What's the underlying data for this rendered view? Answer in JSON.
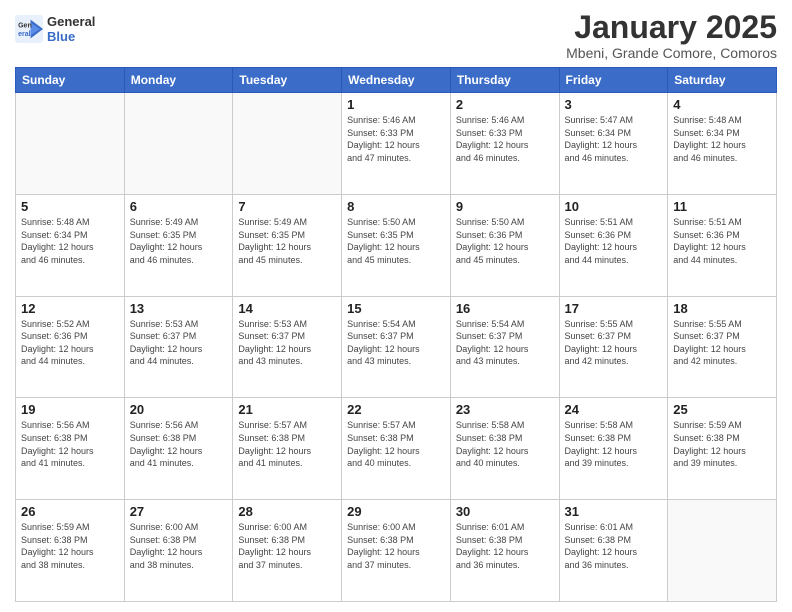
{
  "header": {
    "logo_line1": "General",
    "logo_line2": "Blue",
    "month": "January 2025",
    "location": "Mbeni, Grande Comore, Comoros"
  },
  "weekdays": [
    "Sunday",
    "Monday",
    "Tuesday",
    "Wednesday",
    "Thursday",
    "Friday",
    "Saturday"
  ],
  "weeks": [
    [
      {
        "day": "",
        "info": ""
      },
      {
        "day": "",
        "info": ""
      },
      {
        "day": "",
        "info": ""
      },
      {
        "day": "1",
        "info": "Sunrise: 5:46 AM\nSunset: 6:33 PM\nDaylight: 12 hours\nand 47 minutes."
      },
      {
        "day": "2",
        "info": "Sunrise: 5:46 AM\nSunset: 6:33 PM\nDaylight: 12 hours\nand 46 minutes."
      },
      {
        "day": "3",
        "info": "Sunrise: 5:47 AM\nSunset: 6:34 PM\nDaylight: 12 hours\nand 46 minutes."
      },
      {
        "day": "4",
        "info": "Sunrise: 5:48 AM\nSunset: 6:34 PM\nDaylight: 12 hours\nand 46 minutes."
      }
    ],
    [
      {
        "day": "5",
        "info": "Sunrise: 5:48 AM\nSunset: 6:34 PM\nDaylight: 12 hours\nand 46 minutes."
      },
      {
        "day": "6",
        "info": "Sunrise: 5:49 AM\nSunset: 6:35 PM\nDaylight: 12 hours\nand 46 minutes."
      },
      {
        "day": "7",
        "info": "Sunrise: 5:49 AM\nSunset: 6:35 PM\nDaylight: 12 hours\nand 45 minutes."
      },
      {
        "day": "8",
        "info": "Sunrise: 5:50 AM\nSunset: 6:35 PM\nDaylight: 12 hours\nand 45 minutes."
      },
      {
        "day": "9",
        "info": "Sunrise: 5:50 AM\nSunset: 6:36 PM\nDaylight: 12 hours\nand 45 minutes."
      },
      {
        "day": "10",
        "info": "Sunrise: 5:51 AM\nSunset: 6:36 PM\nDaylight: 12 hours\nand 44 minutes."
      },
      {
        "day": "11",
        "info": "Sunrise: 5:51 AM\nSunset: 6:36 PM\nDaylight: 12 hours\nand 44 minutes."
      }
    ],
    [
      {
        "day": "12",
        "info": "Sunrise: 5:52 AM\nSunset: 6:36 PM\nDaylight: 12 hours\nand 44 minutes."
      },
      {
        "day": "13",
        "info": "Sunrise: 5:53 AM\nSunset: 6:37 PM\nDaylight: 12 hours\nand 44 minutes."
      },
      {
        "day": "14",
        "info": "Sunrise: 5:53 AM\nSunset: 6:37 PM\nDaylight: 12 hours\nand 43 minutes."
      },
      {
        "day": "15",
        "info": "Sunrise: 5:54 AM\nSunset: 6:37 PM\nDaylight: 12 hours\nand 43 minutes."
      },
      {
        "day": "16",
        "info": "Sunrise: 5:54 AM\nSunset: 6:37 PM\nDaylight: 12 hours\nand 43 minutes."
      },
      {
        "day": "17",
        "info": "Sunrise: 5:55 AM\nSunset: 6:37 PM\nDaylight: 12 hours\nand 42 minutes."
      },
      {
        "day": "18",
        "info": "Sunrise: 5:55 AM\nSunset: 6:37 PM\nDaylight: 12 hours\nand 42 minutes."
      }
    ],
    [
      {
        "day": "19",
        "info": "Sunrise: 5:56 AM\nSunset: 6:38 PM\nDaylight: 12 hours\nand 41 minutes."
      },
      {
        "day": "20",
        "info": "Sunrise: 5:56 AM\nSunset: 6:38 PM\nDaylight: 12 hours\nand 41 minutes."
      },
      {
        "day": "21",
        "info": "Sunrise: 5:57 AM\nSunset: 6:38 PM\nDaylight: 12 hours\nand 41 minutes."
      },
      {
        "day": "22",
        "info": "Sunrise: 5:57 AM\nSunset: 6:38 PM\nDaylight: 12 hours\nand 40 minutes."
      },
      {
        "day": "23",
        "info": "Sunrise: 5:58 AM\nSunset: 6:38 PM\nDaylight: 12 hours\nand 40 minutes."
      },
      {
        "day": "24",
        "info": "Sunrise: 5:58 AM\nSunset: 6:38 PM\nDaylight: 12 hours\nand 39 minutes."
      },
      {
        "day": "25",
        "info": "Sunrise: 5:59 AM\nSunset: 6:38 PM\nDaylight: 12 hours\nand 39 minutes."
      }
    ],
    [
      {
        "day": "26",
        "info": "Sunrise: 5:59 AM\nSunset: 6:38 PM\nDaylight: 12 hours\nand 38 minutes."
      },
      {
        "day": "27",
        "info": "Sunrise: 6:00 AM\nSunset: 6:38 PM\nDaylight: 12 hours\nand 38 minutes."
      },
      {
        "day": "28",
        "info": "Sunrise: 6:00 AM\nSunset: 6:38 PM\nDaylight: 12 hours\nand 37 minutes."
      },
      {
        "day": "29",
        "info": "Sunrise: 6:00 AM\nSunset: 6:38 PM\nDaylight: 12 hours\nand 37 minutes."
      },
      {
        "day": "30",
        "info": "Sunrise: 6:01 AM\nSunset: 6:38 PM\nDaylight: 12 hours\nand 36 minutes."
      },
      {
        "day": "31",
        "info": "Sunrise: 6:01 AM\nSunset: 6:38 PM\nDaylight: 12 hours\nand 36 minutes."
      },
      {
        "day": "",
        "info": ""
      }
    ]
  ]
}
